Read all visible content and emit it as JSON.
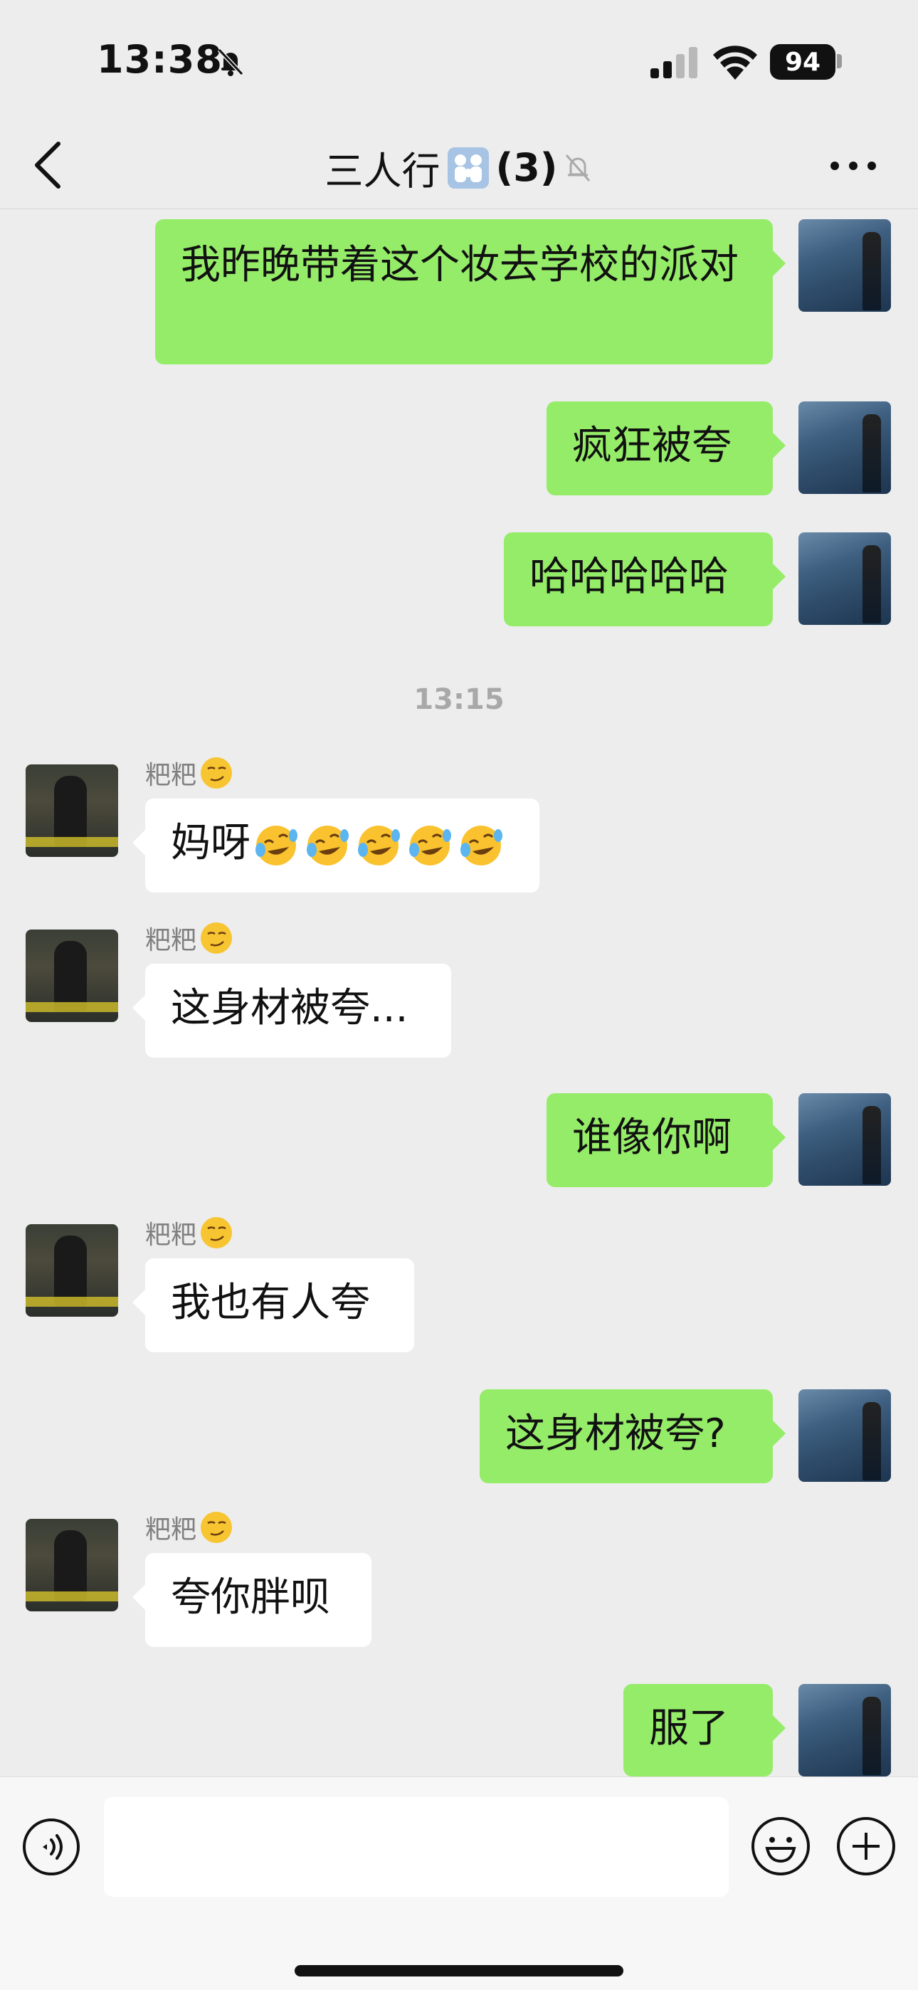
{
  "status_bar": {
    "time": "13:38",
    "battery": "94",
    "icons": [
      "bell-slash-icon",
      "cellular-signal-icon",
      "wifi-icon",
      "battery-icon"
    ]
  },
  "header": {
    "title": "三人行",
    "member_count": "(3)",
    "icons": [
      "back-chevron-icon",
      "group-emoji-icon",
      "muted-bell-icon",
      "more-dots-icon"
    ]
  },
  "messages": [
    {
      "side": "mine",
      "text": "我昨晚带着这个妆去学校的派对"
    },
    {
      "side": "mine",
      "text": "疯狂被夸"
    },
    {
      "side": "mine",
      "text": "哈哈哈哈哈"
    },
    {
      "side": "theirs",
      "sender": "粑粑",
      "text": "妈呀"
    },
    {
      "side": "theirs",
      "sender": "粑粑",
      "text": "这身材被夸..."
    },
    {
      "side": "mine",
      "text": "谁像你啊"
    },
    {
      "side": "theirs",
      "sender": "粑粑",
      "text": "我也有人夸"
    },
    {
      "side": "mine",
      "text": "这身材被夸?"
    },
    {
      "side": "theirs",
      "sender": "粑粑",
      "text": "夸你胖呗"
    },
    {
      "side": "mine",
      "text": "服了"
    }
  ],
  "timestamp": "13:15",
  "emojis": {
    "sender_suffix": "smirking-face-emoji",
    "crying_laughing": "rolling-on-floor-laughing-emoji"
  },
  "input_bar": {
    "value": "",
    "icons": [
      "voice-icon",
      "emoji-face-icon",
      "plus-icon"
    ]
  },
  "colors": {
    "mine_bubble": "#95ec69",
    "theirs_bubble": "#ffffff",
    "background": "#ededed"
  }
}
